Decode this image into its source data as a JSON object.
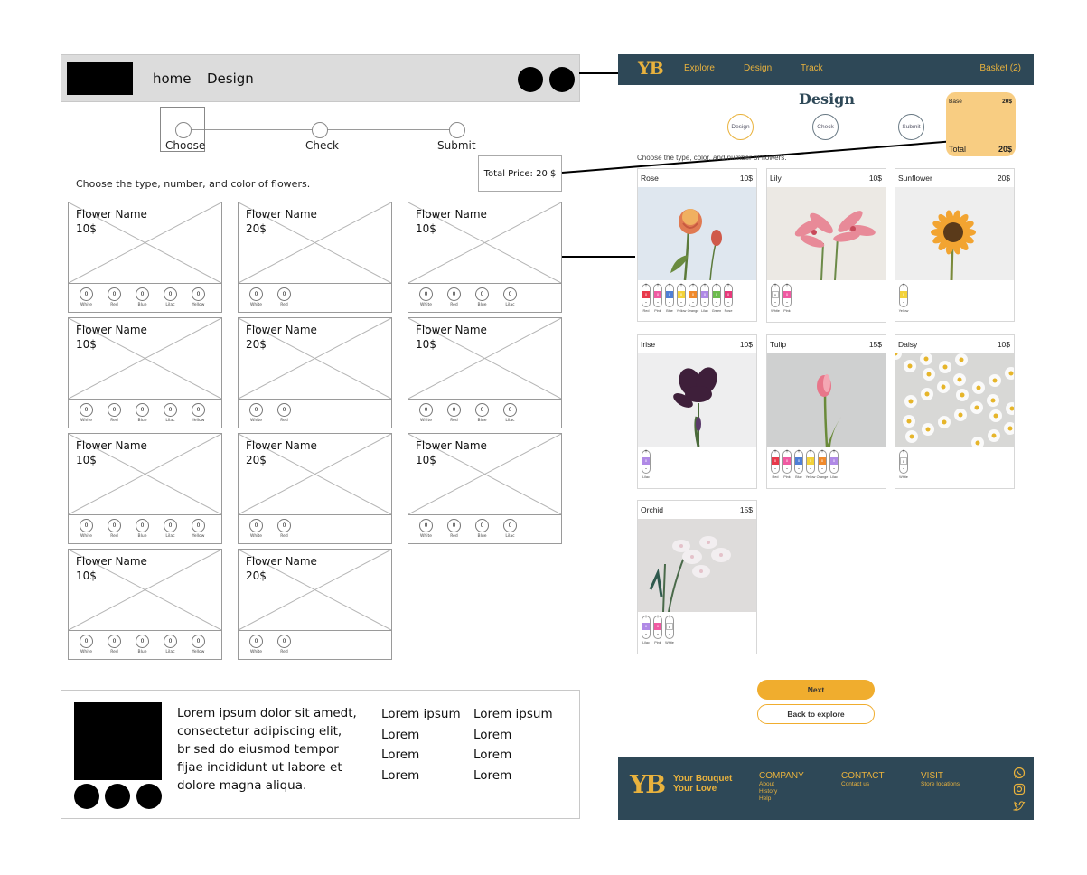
{
  "wireframe": {
    "nav": {
      "links": [
        "home",
        "Design"
      ]
    },
    "steps": [
      "Choose",
      "Check",
      "Submit"
    ],
    "total_price": "Total Price: 20 $",
    "instruction": "Choose the type, number, and color of flowers.",
    "cards": [
      {
        "name": "Flower Name",
        "price": "10$",
        "colors": [
          "White",
          "Red",
          "Blue",
          "Lilac",
          "Yellow"
        ]
      },
      {
        "name": "Flower Name",
        "price": "20$",
        "colors": [
          "White",
          "Red"
        ]
      },
      {
        "name": "Flower Name",
        "price": "10$",
        "colors": [
          "White",
          "Red",
          "Blue",
          "Lilac"
        ]
      },
      {
        "name": "Flower Name",
        "price": "10$",
        "colors": [
          "White",
          "Red",
          "Blue",
          "Lilac",
          "Yellow"
        ]
      },
      {
        "name": "Flower Name",
        "price": "20$",
        "colors": [
          "White",
          "Red"
        ]
      },
      {
        "name": "Flower Name",
        "price": "10$",
        "colors": [
          "White",
          "Red",
          "Blue",
          "Lilac"
        ]
      },
      {
        "name": "Flower Name",
        "price": "10$",
        "colors": [
          "White",
          "Red",
          "Blue",
          "Lilac",
          "Yellow"
        ]
      },
      {
        "name": "Flower Name",
        "price": "20$",
        "colors": [
          "White",
          "Red"
        ]
      },
      {
        "name": "Flower Name",
        "price": "10$",
        "colors": [
          "White",
          "Red",
          "Blue",
          "Lilac"
        ]
      },
      {
        "name": "Flower Name",
        "price": "10$",
        "colors": [
          "White",
          "Red",
          "Blue",
          "Lilac",
          "Yellow"
        ]
      },
      {
        "name": "Flower Name",
        "price": "20$",
        "colors": [
          "White",
          "Red"
        ]
      }
    ],
    "knob_value": "0",
    "footer": {
      "text": "Lorem ipsum dolor sit amedt, consectetur adipiscing elit, br sed do eiusmod tempor  fijae incididunt ut labore et dolore magna aliqua.",
      "col1": [
        "Lorem ipsum",
        "Lorem",
        "Lorem",
        "Lorem"
      ],
      "col2": [
        "Lorem ipsum",
        "Lorem",
        "Lorem",
        "Lorem"
      ]
    }
  },
  "hifi": {
    "nav": {
      "logo": "YB",
      "links": [
        "Explore",
        "Design",
        "Track"
      ],
      "basket": "Basket (2)"
    },
    "title": "Design",
    "steps": [
      "Design",
      "Check",
      "Submit"
    ],
    "price_box": {
      "base_label": "Base",
      "base_value": "20$",
      "total_label": "Total",
      "total_value": "20$"
    },
    "instruction": "Choose the type, color, and number of flowers.",
    "flowers": [
      {
        "name": "Rose",
        "price": "10$",
        "colors": [
          [
            "Red",
            "#e8394b"
          ],
          [
            "Pink",
            "#f05aa2"
          ],
          [
            "Blue",
            "#4f7fd6"
          ],
          [
            "Yellow",
            "#f3d23a"
          ],
          [
            "Orange",
            "#f08a2c"
          ],
          [
            "Lilac",
            "#b08ae6"
          ],
          [
            "Green",
            "#6dbb4e"
          ],
          [
            "Rose",
            "#e8387a"
          ]
        ]
      },
      {
        "name": "Lily",
        "price": "10$",
        "colors": [
          [
            "White",
            "#ffffff"
          ],
          [
            "Pink",
            "#f05aa2"
          ]
        ]
      },
      {
        "name": "Sunflower",
        "price": "20$",
        "colors": [
          [
            "Yellow",
            "#f3d23a"
          ]
        ]
      },
      {
        "name": "Irise",
        "price": "10$",
        "colors": [
          [
            "Lilac",
            "#b08ae6"
          ]
        ]
      },
      {
        "name": "Tulip",
        "price": "15$",
        "colors": [
          [
            "Red",
            "#e8394b"
          ],
          [
            "Pink",
            "#f05aa2"
          ],
          [
            "Blue",
            "#4f7fd6"
          ],
          [
            "Yellow",
            "#f3d23a"
          ],
          [
            "Orange",
            "#f08a2c"
          ],
          [
            "Lilac",
            "#b08ae6"
          ]
        ]
      },
      {
        "name": "Daisy",
        "price": "10$",
        "colors": [
          [
            "White",
            "#ffffff"
          ]
        ]
      },
      {
        "name": "Orchid",
        "price": "15$",
        "colors": [
          [
            "Lilac",
            "#b08ae6"
          ],
          [
            "Pink",
            "#f05aa2"
          ],
          [
            "White",
            "#ffffff"
          ]
        ]
      }
    ],
    "swatch_value": "0",
    "buttons": {
      "next": "Next",
      "back": "Back to explore"
    },
    "footer": {
      "logo": "YB",
      "tagline_1": "Your Bouquet",
      "tagline_2": "Your Love",
      "company": {
        "title": "COMPANY",
        "items": [
          "About",
          "History",
          "Help"
        ]
      },
      "contact": {
        "title": "CONTACT",
        "items": [
          "Contact us"
        ]
      },
      "visit": {
        "title": "VISIT",
        "items": [
          "Store locations"
        ]
      },
      "social_icons": [
        "whatsapp-icon",
        "instagram-icon",
        "twitter-icon"
      ]
    },
    "colors": {
      "navy": "#2e4857",
      "gold": "#e9b23d",
      "button": "#f0ad2e",
      "price_box": "#f8cd82"
    }
  }
}
